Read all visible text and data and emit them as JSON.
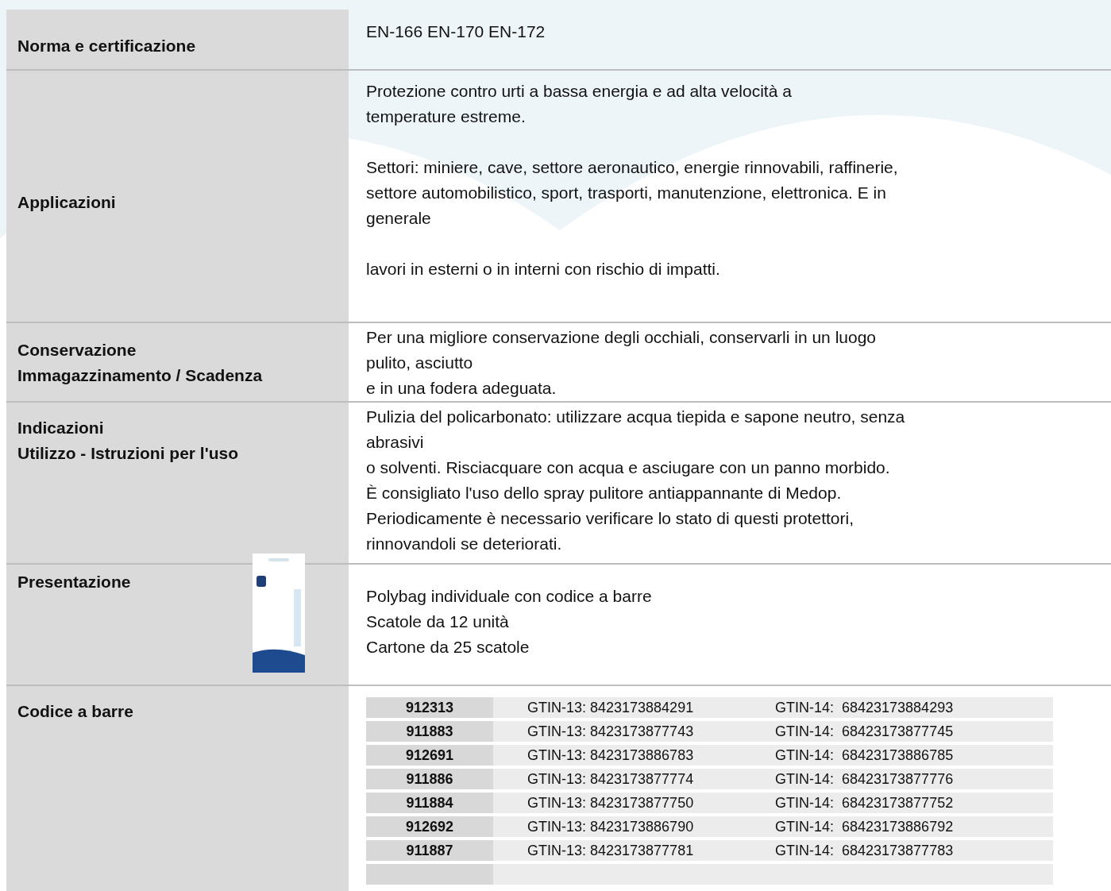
{
  "rows": [
    {
      "kind": "text",
      "label": [
        "Norma e certificazione"
      ],
      "paragraphs": [
        [
          "EN-166  EN-170  EN-172"
        ]
      ]
    },
    {
      "kind": "text",
      "label": [
        "Applicazioni"
      ],
      "paragraphs": [
        [
          "Protezione contro urti a bassa energia e ad alta velocità a",
          "temperature estreme."
        ],
        [
          "Settori: miniere, cave, settore aeronautico, energie rinnovabili, raffinerie,",
          "settore automobilistico, sport, trasporti, manutenzione, elettronica. E in",
          "generale"
        ],
        [
          "lavori in esterni o in interni con rischio di impatti."
        ]
      ]
    },
    {
      "kind": "text",
      "label": [
        "Conservazione",
        "Immagazzinamento / Scadenza"
      ],
      "paragraphs": [
        [
          "Per una migliore conservazione degli occhiali, conservarli in un luogo",
          "pulito, asciutto",
          "e in una fodera adeguata."
        ]
      ]
    },
    {
      "kind": "text",
      "label": [
        "Indicazioni",
        "Utilizzo - Istruzioni per l'uso"
      ],
      "paragraphs": [
        [
          "Pulizia del policarbonato: utilizzare acqua tiepida e sapone neutro, senza",
          "abrasivi",
          "o solventi. Risciacquare con acqua e asciugare con un panno morbido.",
          "È consigliato l'uso dello spray pulitore antiappannante di Medop.",
          "Periodicamente è necessario verificare lo stato di questi protettori,",
          "rinnovandoli se deteriorati."
        ]
      ]
    },
    {
      "kind": "image",
      "label": [
        "Presentazione"
      ],
      "paragraphs": [
        [
          "Polybag individuale con codice a barre",
          "Scatole da 12 unità",
          "Cartone da 25 scatole"
        ]
      ]
    },
    {
      "kind": "barcodes",
      "label": [
        "Codice a barre"
      ],
      "barcodes": [
        {
          "code": "912313",
          "gtin13": "GTIN-13: 8423173884291",
          "gtin14": "GTIN-14:  68423173884293"
        },
        {
          "code": "911883",
          "gtin13": "GTIN-13: 8423173877743",
          "gtin14": "GTIN-14:  68423173877745"
        },
        {
          "code": "912691",
          "gtin13": "GTIN-13: 8423173886783",
          "gtin14": "GTIN-14:  68423173886785"
        },
        {
          "code": "911886",
          "gtin13": "GTIN-13: 8423173877774",
          "gtin14": "GTIN-14:  68423173877776"
        },
        {
          "code": "911884",
          "gtin13": "GTIN-13: 8423173877750",
          "gtin14": "GTIN-14:  68423173877752"
        },
        {
          "code": "912692",
          "gtin13": "GTIN-13: 8423173886790",
          "gtin14": "GTIN-14:  68423173886792"
        },
        {
          "code": "911887",
          "gtin13": "GTIN-13: 8423173877781",
          "gtin14": "GTIN-14:  68423173877783"
        }
      ]
    }
  ]
}
